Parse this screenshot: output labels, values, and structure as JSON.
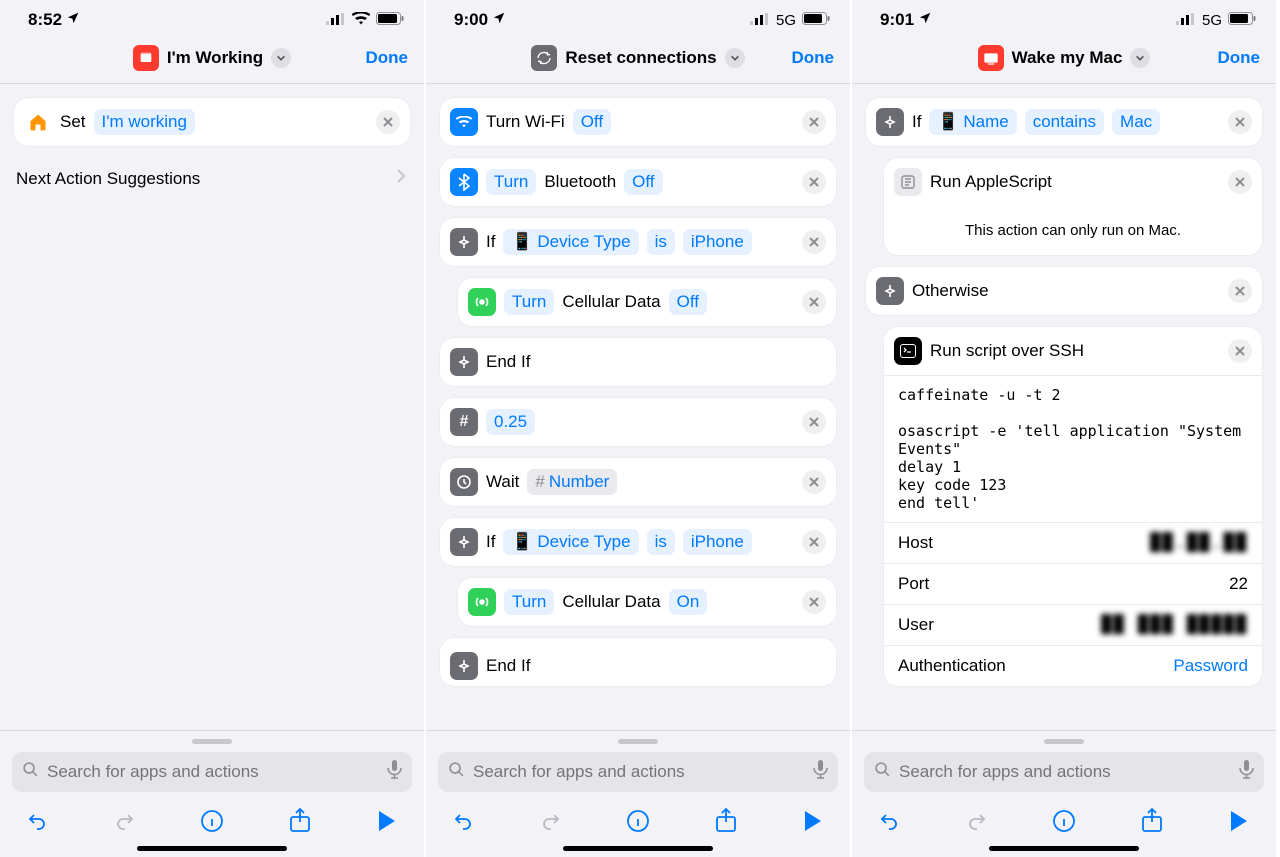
{
  "phones": [
    {
      "status": {
        "time": "8:52",
        "net": "wifi"
      },
      "header": {
        "title": "I'm Working",
        "done": "Done",
        "icon_color": "#ff3b30"
      },
      "actions": [
        {
          "icon": "home",
          "icon_color": "#ff9500",
          "lead": "Set",
          "params": [
            "I'm working"
          ]
        }
      ],
      "suggestion_label": "Next Action Suggestions"
    },
    {
      "status": {
        "time": "9:00",
        "net": "5G"
      },
      "header": {
        "title": "Reset connections",
        "done": "Done",
        "icon_color": "#6b6b72"
      },
      "actions": [
        {
          "icon": "wifi",
          "icon_color": "#0a84ff",
          "lead": "Turn Wi-Fi",
          "params": [
            "Off"
          ]
        },
        {
          "icon": "bt",
          "icon_color": "#0a84ff",
          "lead_param": "Turn",
          "lead": "Bluetooth",
          "params": [
            "Off"
          ]
        },
        {
          "icon": "branch",
          "icon_color": "#6b6b72",
          "lead": "If",
          "params": [
            "📱 Device Type",
            "is",
            "iPhone"
          ]
        },
        {
          "indent": true,
          "icon": "cell",
          "icon_color": "#30d158",
          "lead_param": "Turn",
          "lead": "Cellular Data",
          "params": [
            "Off"
          ]
        },
        {
          "icon": "branch",
          "icon_color": "#6b6b72",
          "lead": "End If"
        },
        {
          "icon": "hash",
          "icon_color": "#6b6b72",
          "params": [
            "0.25"
          ]
        },
        {
          "icon": "clock",
          "icon_color": "#6b6b72",
          "lead": "Wait",
          "params": [
            "# Number"
          ],
          "param_style": "pill"
        },
        {
          "icon": "branch",
          "icon_color": "#6b6b72",
          "lead": "If",
          "params": [
            "📱 Device Type",
            "is",
            "iPhone"
          ]
        },
        {
          "indent": true,
          "icon": "cell",
          "icon_color": "#30d158",
          "lead_param": "Turn",
          "lead": "Cellular Data",
          "params": [
            "On"
          ]
        },
        {
          "icon": "branch",
          "icon_color": "#6b6b72",
          "lead": "End If",
          "cut": true
        }
      ]
    },
    {
      "status": {
        "time": "9:01",
        "net": "5G"
      },
      "header": {
        "title": "Wake my Mac",
        "done": "Done",
        "icon_color": "#ff3b30"
      },
      "actions": [
        {
          "icon": "branch",
          "icon_color": "#6b6b72",
          "lead": "If",
          "params": [
            "📱 Name",
            "contains",
            "Mac"
          ]
        },
        {
          "indent": true,
          "icon": "scpt",
          "icon_color": "#e9e9ee",
          "lead": "Run AppleScript",
          "note": "This action can only run on Mac."
        },
        {
          "icon": "branch",
          "icon_color": "#6b6b72",
          "lead": "Otherwise"
        },
        {
          "indent": true,
          "icon": "terminal",
          "icon_color": "#000",
          "lead": "Run script over SSH",
          "script": "caffeinate -u -t 2\n\nosascript -e 'tell application \"System Events\"\ndelay 1\nkey code 123\nend tell'",
          "fields": [
            {
              "k": "Host",
              "v": "██.██.██",
              "redact": true
            },
            {
              "k": "Port",
              "v": "22"
            },
            {
              "k": "User",
              "v": "██ ███ █████",
              "redact": true
            },
            {
              "k": "Authentication",
              "v": "Password",
              "link": true
            }
          ]
        }
      ]
    }
  ],
  "footer": {
    "search_placeholder": "Search for apps and actions"
  }
}
